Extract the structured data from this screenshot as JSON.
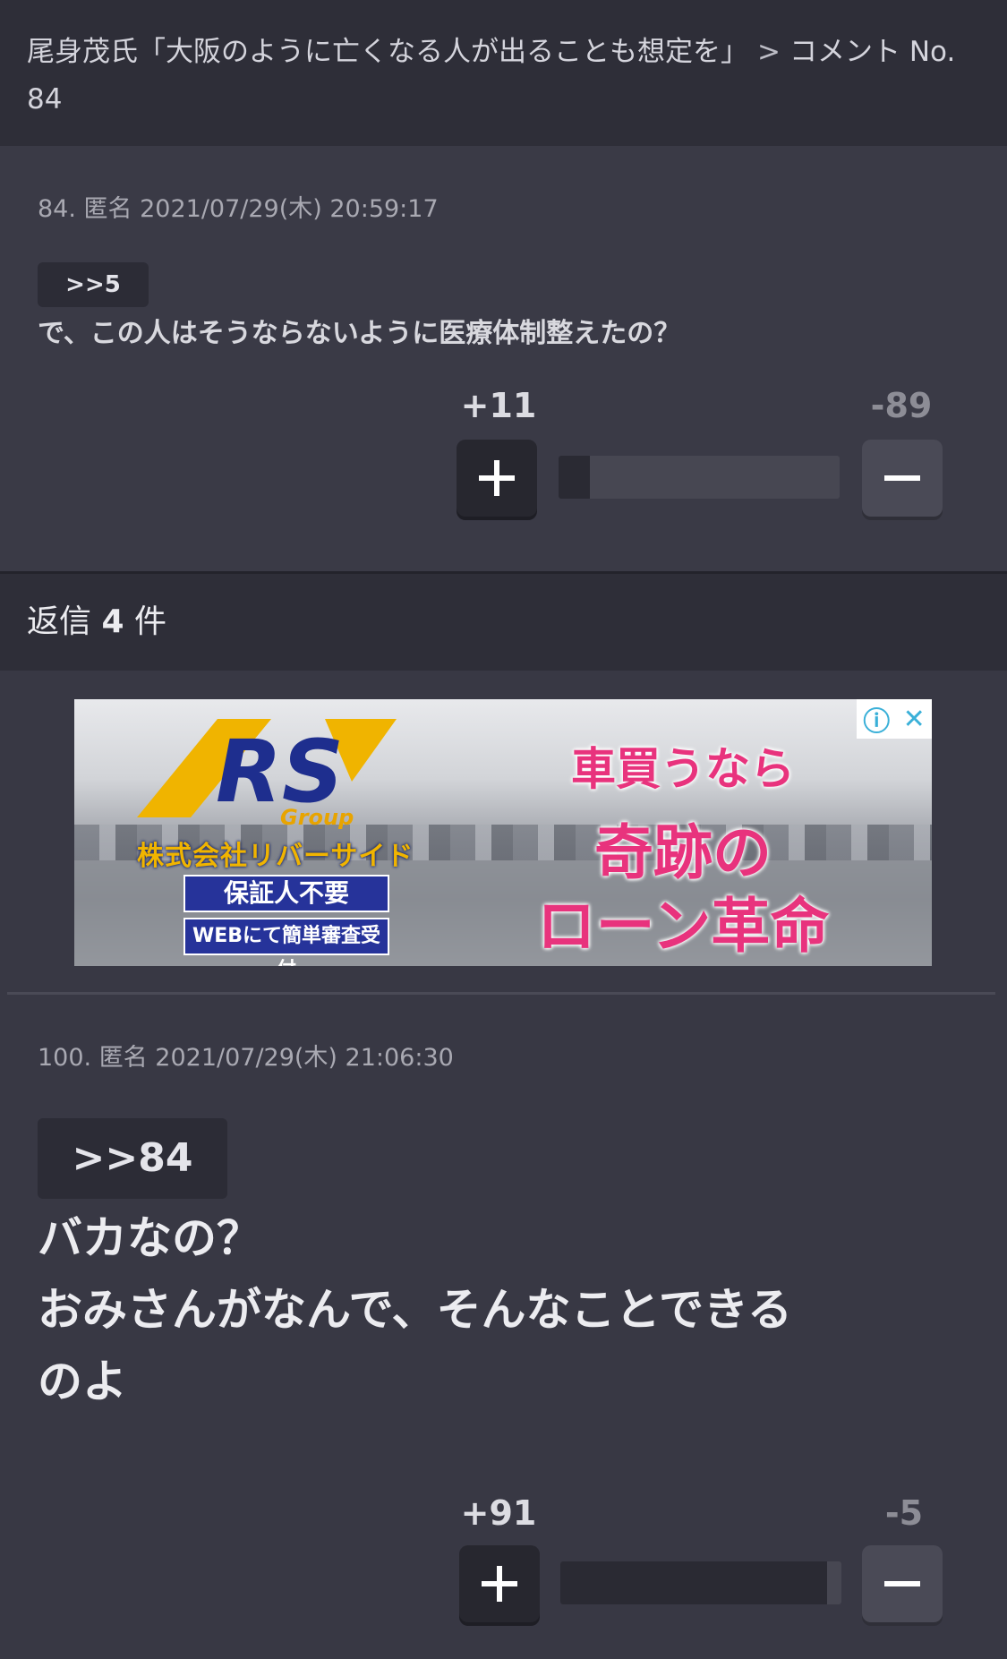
{
  "header": {
    "title": "尾身茂氏「大阪のように亡くなる人が出ることも想定を」",
    "separator": ">",
    "crumb": "コメント No. 84"
  },
  "comment1": {
    "meta": "84. 匿名 2021/07/29(木) 20:59:17",
    "reply_to": ">>5",
    "body": "で、この人はそうならないように医療体制整えたの？",
    "plus_count": "+11",
    "minus_count": "-89",
    "plus_ratio": 0.11
  },
  "replies": {
    "prefix": "返信",
    "count": "4",
    "suffix": "件"
  },
  "ad": {
    "logo_text": "RS",
    "group_label": "Group",
    "company": "株式会社リバーサイド",
    "badge1": "保証人不要",
    "badge2": "WEBにて簡単審査受付",
    "headline1": "車買うなら",
    "headline2": "奇跡の",
    "headline3": "ローン革命",
    "info_icon": "ⓘ",
    "close_icon": "✕"
  },
  "comment2": {
    "meta": "100. 匿名 2021/07/29(木) 21:06:30",
    "reply_to": ">>84",
    "line1": "バカなの？",
    "line2": "おみさんがなんで、そんなことできる",
    "line3": "のよ",
    "plus_count": "+91",
    "minus_count": "-5",
    "plus_ratio": 0.948
  },
  "colors": {
    "background": "#383844",
    "header_bg": "#2e2e38",
    "ad_pink": "#e8337d",
    "ad_blue": "#26339a"
  }
}
